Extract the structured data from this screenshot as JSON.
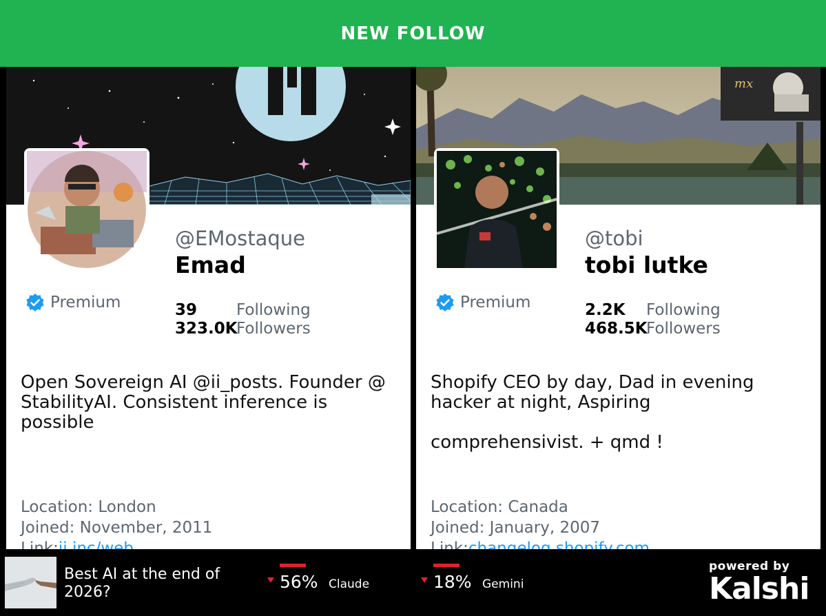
{
  "header": {
    "title": "NEW FOLLOW"
  },
  "profiles": [
    {
      "handle": "@EMostaque",
      "name": "Emad",
      "badge": "Premium",
      "following_count": "39",
      "following_label": "Following",
      "followers_count": "323.0K",
      "followers_label": "Followers",
      "bio": "Open Sovereign AI @ii_posts. Founder @ StabilityAI. Consistent inference is possible",
      "location": "Location: London",
      "joined": "Joined: November, 2011",
      "link_prefix": "Link:",
      "link": "ii.inc/web"
    },
    {
      "handle": "@tobi",
      "name": "tobi lutke",
      "badge": "Premium",
      "following_count": "2.2K",
      "following_label": "Following",
      "followers_count": "468.5K",
      "followers_label": "Followers",
      "bio": "Shopify CEO by day, Dad in evening hacker at night, Aspiring\n\ncomprehensivist. + qmd !",
      "location": "Location: Canada",
      "joined": "Joined: January, 2007",
      "link_prefix": "Link:",
      "link": "changelog.shopify.com"
    }
  ],
  "market": {
    "question": "Best AI at the end of 2026?",
    "options": [
      {
        "percent": "56%",
        "candidate": "Claude"
      },
      {
        "percent": "18%",
        "candidate": "Gemini"
      }
    ],
    "powered_by": "powered by",
    "brand": "Kalshi"
  },
  "colors": {
    "accent_green": "#21b352",
    "verified_blue": "#1d9bf0",
    "down_red": "#e2212e"
  }
}
